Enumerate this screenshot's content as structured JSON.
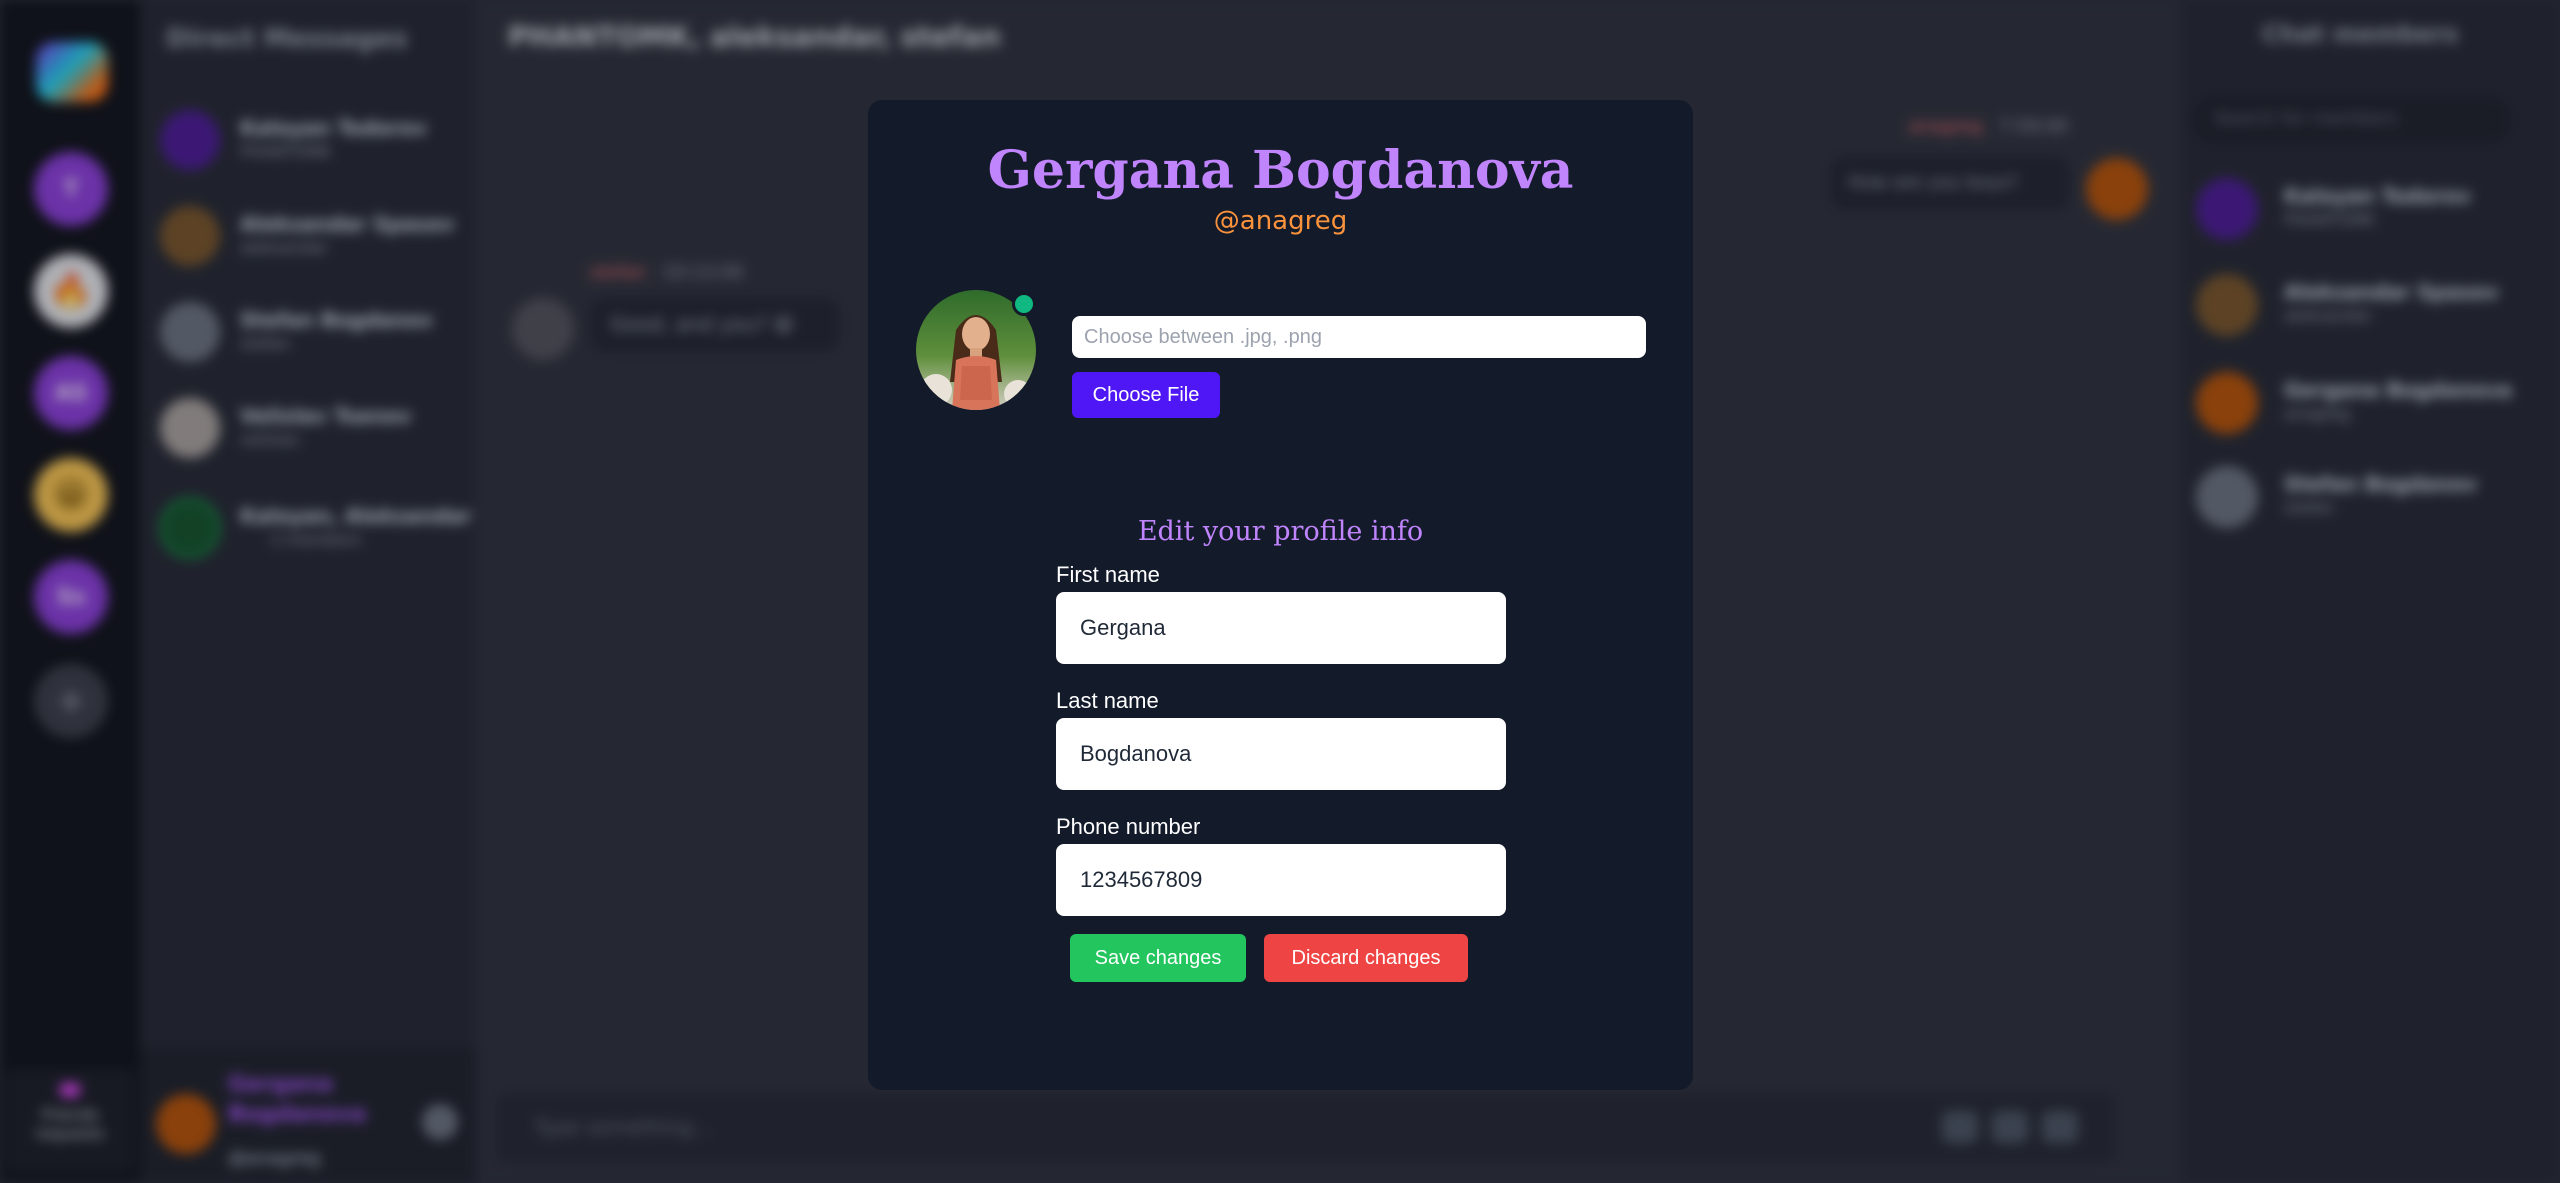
{
  "background": {
    "dm_panel": {
      "title": "Direct Messages",
      "items": [
        {
          "name": "Kaloyan Todorov",
          "sub": "PHANTOMK"
        },
        {
          "name": "Aleksandar Spasov",
          "sub": "aleksandar"
        },
        {
          "name": "Stefan Bogdanov",
          "sub": "stefan"
        },
        {
          "name": "Velislav Tsenov",
          "sub": "velislav"
        },
        {
          "name": "Kaloyan, Aleksandar",
          "sub": "3 members"
        }
      ]
    },
    "servers": [
      {
        "label": "T",
        "icon": "letter-icon"
      },
      {
        "label": "🔥",
        "icon": "fire-emoji-icon"
      },
      {
        "label": "AS",
        "icon": "letter-icon"
      },
      {
        "label": "😁",
        "icon": "grin-emoji-icon"
      },
      {
        "label": "Ss",
        "icon": "letter-icon"
      },
      {
        "label": "+",
        "icon": "plus-icon"
      }
    ],
    "friend_requests": "Friends requests",
    "current_user": {
      "name": "Gergana Bogdanova",
      "handle": "@anagreg"
    },
    "chat": {
      "title": "PHANTOMK, aleksandar, stefan",
      "messages": [
        {
          "author": "stefan",
          "time": "10:13:59",
          "text": "Good, and you? 😀"
        },
        {
          "author": "anagreg",
          "time": "7:59:00",
          "text": "How are you boys?"
        }
      ],
      "composer_placeholder": "Type something..."
    },
    "members": {
      "title": "Chat members",
      "search_placeholder": "Search for members",
      "items": [
        {
          "name": "Kaloyan Todorov",
          "sub": "PHANTOMK"
        },
        {
          "name": "Aleksandar Spasov",
          "sub": "aleksandar"
        },
        {
          "name": "Gergana Bogdanova",
          "sub": "anagreg"
        },
        {
          "name": "Stefan Bogdanov",
          "sub": "stefan"
        }
      ]
    }
  },
  "modal": {
    "full_name": "Gergana Bogdanova",
    "handle": "@anagreg",
    "status_color": "#10b981",
    "file_placeholder": "Choose between .jpg, .png",
    "choose_file_label": "Choose File",
    "edit_title": "Edit your profile info",
    "first_name_label": "First name",
    "first_name_value": "Gergana",
    "last_name_label": "Last name",
    "last_name_value": "Bogdanova",
    "phone_label": "Phone number",
    "phone_value": "1234567809",
    "save_label": "Save changes",
    "discard_label": "Discard changes"
  },
  "colors": {
    "accent_purple": "#c084fc",
    "handle_orange": "#fb923c",
    "choose_blue": "#4f17f5",
    "save_green": "#22c55e",
    "discard_red": "#ef4444"
  }
}
